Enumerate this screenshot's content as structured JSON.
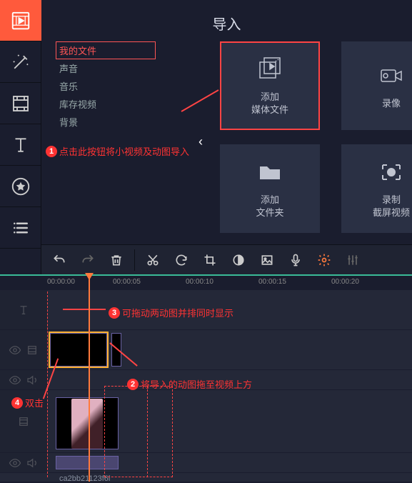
{
  "title": "导入",
  "leftTools": [
    "media",
    "wand",
    "film",
    "text",
    "star",
    "list"
  ],
  "sideItems": [
    {
      "label": "我的文件",
      "active": true
    },
    {
      "label": "声音"
    },
    {
      "label": "音乐"
    },
    {
      "label": "库存视频"
    },
    {
      "label": "背景"
    }
  ],
  "cards": {
    "addMedia": {
      "line1": "添加",
      "line2": "媒体文件"
    },
    "record": {
      "label": "录像"
    },
    "addFolder": {
      "line1": "添加",
      "line2": "文件夹"
    },
    "screencast": {
      "line1": "录制",
      "line2": "截屏视频"
    }
  },
  "annotations": {
    "a1": "点击此按钮将小视频及动图导入",
    "a2": "将导入的动图拖至视频上方",
    "a3": "可拖动两动图并排同时显示",
    "a4": "双击"
  },
  "ticks": [
    "00:00:00",
    "00:00:05",
    "00:00:10",
    "00:00:15",
    "00:00:20"
  ],
  "clipLabel": "ca2bb21123f6l"
}
